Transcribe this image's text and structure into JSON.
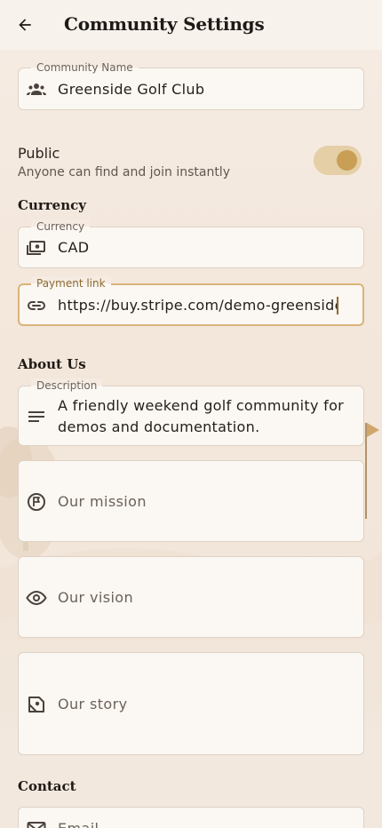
{
  "appbar": {
    "title": "Community Settings",
    "back_icon": "arrow-back-icon"
  },
  "community_name": {
    "label": "Community Name",
    "value": "Greenside Golf Club",
    "icon": "groups-icon"
  },
  "visibility": {
    "label": "Public",
    "description": "Anyone can find and join instantly",
    "enabled": true,
    "accent": "#c99e55",
    "track": "#e4cfa6"
  },
  "currency_section": {
    "title": "Currency",
    "currency_field": {
      "label": "Currency",
      "value": "CAD",
      "icon": "payments-icon"
    },
    "payment_link": {
      "label": "Payment link",
      "value": "https://buy.stripe.com/demo-greenside",
      "icon": "link-icon",
      "focused": true
    }
  },
  "about_section": {
    "title": "About Us",
    "description": {
      "label": "Description",
      "value": "A friendly weekend golf community for demos and documentation.",
      "icon": "notes-icon"
    },
    "mission": {
      "placeholder": "Our mission",
      "icon": "flag-circle-icon"
    },
    "vision": {
      "placeholder": "Our vision",
      "icon": "eye-icon"
    },
    "story": {
      "placeholder": "Our story",
      "icon": "history-book-icon"
    }
  },
  "contact_section": {
    "title": "Contact",
    "email": {
      "placeholder": "Email",
      "icon": "mail-icon"
    }
  },
  "colors": {
    "focus_border": "#d8b47a",
    "background": "#f4e9df"
  }
}
